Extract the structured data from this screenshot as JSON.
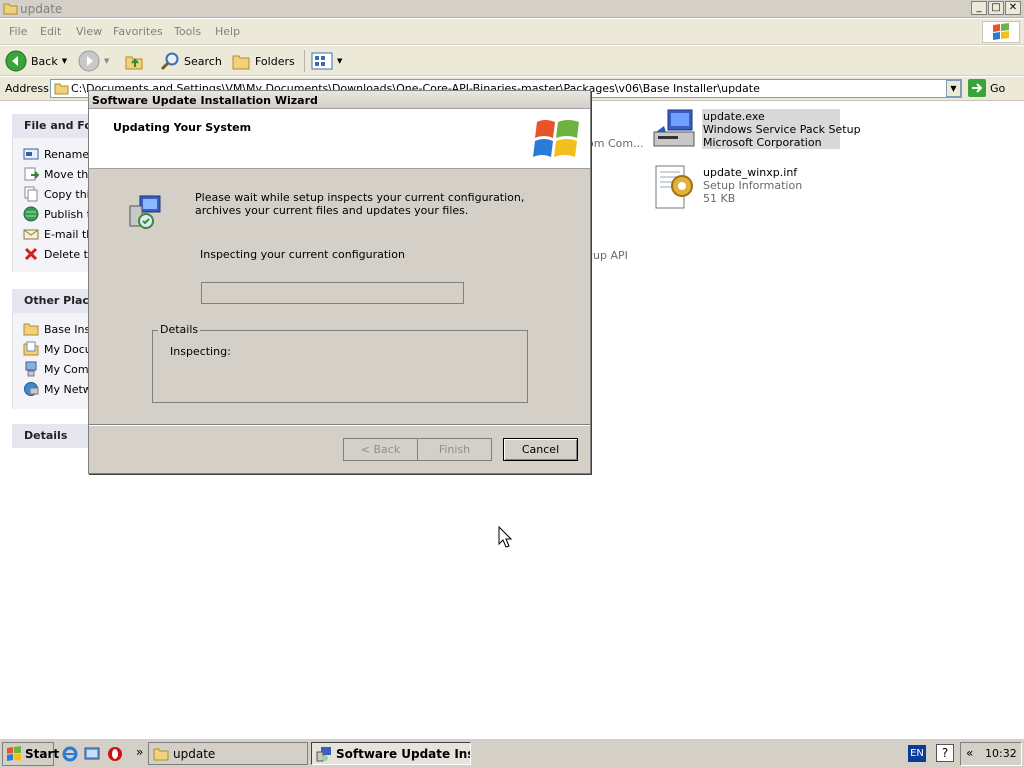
{
  "window": {
    "title": "update",
    "controls": {
      "minimize": "_",
      "maximize": "□",
      "close": "✕"
    }
  },
  "menubar": {
    "items": [
      {
        "label": "File"
      },
      {
        "label": "Edit"
      },
      {
        "label": "View"
      },
      {
        "label": "Favorites"
      },
      {
        "label": "Tools"
      },
      {
        "label": "Help"
      }
    ]
  },
  "toolbar": {
    "back_label": "Back",
    "search_label": "Search",
    "folders_label": "Folders"
  },
  "address": {
    "label": "Address",
    "path": "C:\\Documents and Settings\\VM\\My Documents\\Downloads\\One-Core-API-Binaries-master\\Packages\\v06\\Base Installer\\update",
    "go_label": "Go"
  },
  "left_pane": {
    "file_tasks_header": "File and Fol",
    "file_tasks": [
      {
        "label": "Rename",
        "icon": "rename-icon"
      },
      {
        "label": "Move thi",
        "icon": "move-icon"
      },
      {
        "label": "Copy thi",
        "icon": "copy-icon"
      },
      {
        "label": "Publish t",
        "icon": "publish-icon"
      },
      {
        "label": "E-mail th",
        "icon": "email-icon"
      },
      {
        "label": "Delete th",
        "icon": "delete-icon"
      }
    ],
    "other_places_header": "Other Place",
    "other_places": [
      {
        "label": "Base Ins",
        "icon": "folder-icon"
      },
      {
        "label": "My Docu",
        "icon": "documents-icon"
      },
      {
        "label": "My Comp",
        "icon": "computer-icon"
      },
      {
        "label": "My Netw",
        "icon": "network-icon"
      }
    ],
    "details_header": "Details"
  },
  "files": [
    {
      "name": "update.exe",
      "line2": "Windows Service Pack Setup",
      "line3": "Microsoft Corporation",
      "selected": true
    },
    {
      "name": "update_winxp.inf",
      "line2": "Setup Information",
      "line3": "51 KB",
      "selected": false
    }
  ],
  "partial_labels": {
    "com": "om Com...",
    "setupapi": "cup API"
  },
  "dialog": {
    "title": "Software Update Installation Wizard",
    "header": "Updating Your System",
    "message": "Please wait while setup inspects your current configuration, archives your current files and updates your files.",
    "status": "Inspecting your current configuration",
    "progress": 0,
    "details_legend": "Details",
    "details_text": "Inspecting:",
    "buttons": {
      "back": "< Back",
      "finish": "Finish",
      "cancel": "Cancel"
    }
  },
  "taskbar": {
    "start_label": "Start",
    "chevron": "»",
    "tasks": [
      {
        "label": "update",
        "active": false
      },
      {
        "label": "Software Update Inst...",
        "active": true
      }
    ],
    "language": "EN",
    "tray_chevron": "«",
    "clock": "10:32"
  },
  "colors": {
    "dialog_face": "#d4d0c8",
    "address_border": "#7f9db9",
    "selection": "#d9d9d9"
  }
}
